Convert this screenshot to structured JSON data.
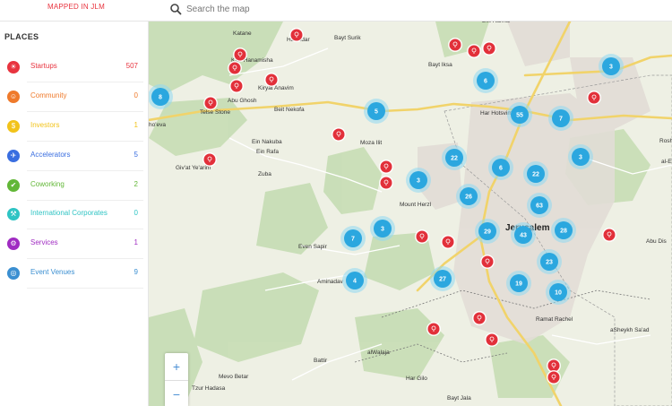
{
  "header": {
    "brand": "MAPPED IN JLM",
    "search_placeholder": "Search the map"
  },
  "sidebar": {
    "title": "PLACES",
    "categories": [
      {
        "label": "Startups",
        "count": "507",
        "color": "#e8343f",
        "icon": "bulb-icon"
      },
      {
        "label": "Community",
        "count": "0",
        "color": "#ef7a2b",
        "icon": "people-icon"
      },
      {
        "label": "Investors",
        "count": "1",
        "color": "#f2c31a",
        "icon": "dollar-icon"
      },
      {
        "label": "Accelerators",
        "count": "5",
        "color": "#3a6ee0",
        "icon": "rocket-icon"
      },
      {
        "label": "Coworking",
        "count": "2",
        "color": "#62b737",
        "icon": "thumbs-up-icon"
      },
      {
        "label": "International Corporates",
        "count": "0",
        "color": "#2fc4c4",
        "icon": "wrench-icon"
      },
      {
        "label": "Services",
        "count": "1",
        "color": "#a02cc2",
        "icon": "gear-icon"
      },
      {
        "label": "Event Venues",
        "count": "9",
        "color": "#3b8fd1",
        "icon": "globe-icon"
      }
    ]
  },
  "map": {
    "zoom_in": "+",
    "zoom_out": "−",
    "labels": [
      "Katane",
      "Har Adar",
      "Bayt Surik",
      "Bet Harina",
      "Kfar Hanamisha",
      "Kiryat Anavim",
      "Bayt Iksa",
      "Abu Ghosh",
      "Telse Stone",
      "Har Hotsvim",
      "Beit Nekofa",
      "ho'eva",
      "Ein Nakuba",
      "Ein Rafa",
      "Moza Ilit",
      "Giv'at Ye'arim",
      "Zuba",
      "Mount Herzl",
      "Jerusalem",
      "Even Sapir",
      "Aminadav",
      "Abu Dis",
      "Ramat Rachel",
      "aSheykh Sa'ad",
      "Battir",
      "alWalaja",
      "Mevo Betar",
      "Tzur Hadasa",
      "Har Gilo",
      "Bayt Jala",
      "al-Eiz",
      "Rosh"
    ],
    "clusters": [
      "8",
      "3",
      "6",
      "55",
      "7",
      "5",
      "22",
      "6",
      "22",
      "3",
      "3",
      "26",
      "63",
      "3",
      "28",
      "43",
      "29",
      "7",
      "23",
      "4",
      "27",
      "19",
      "10"
    ]
  }
}
